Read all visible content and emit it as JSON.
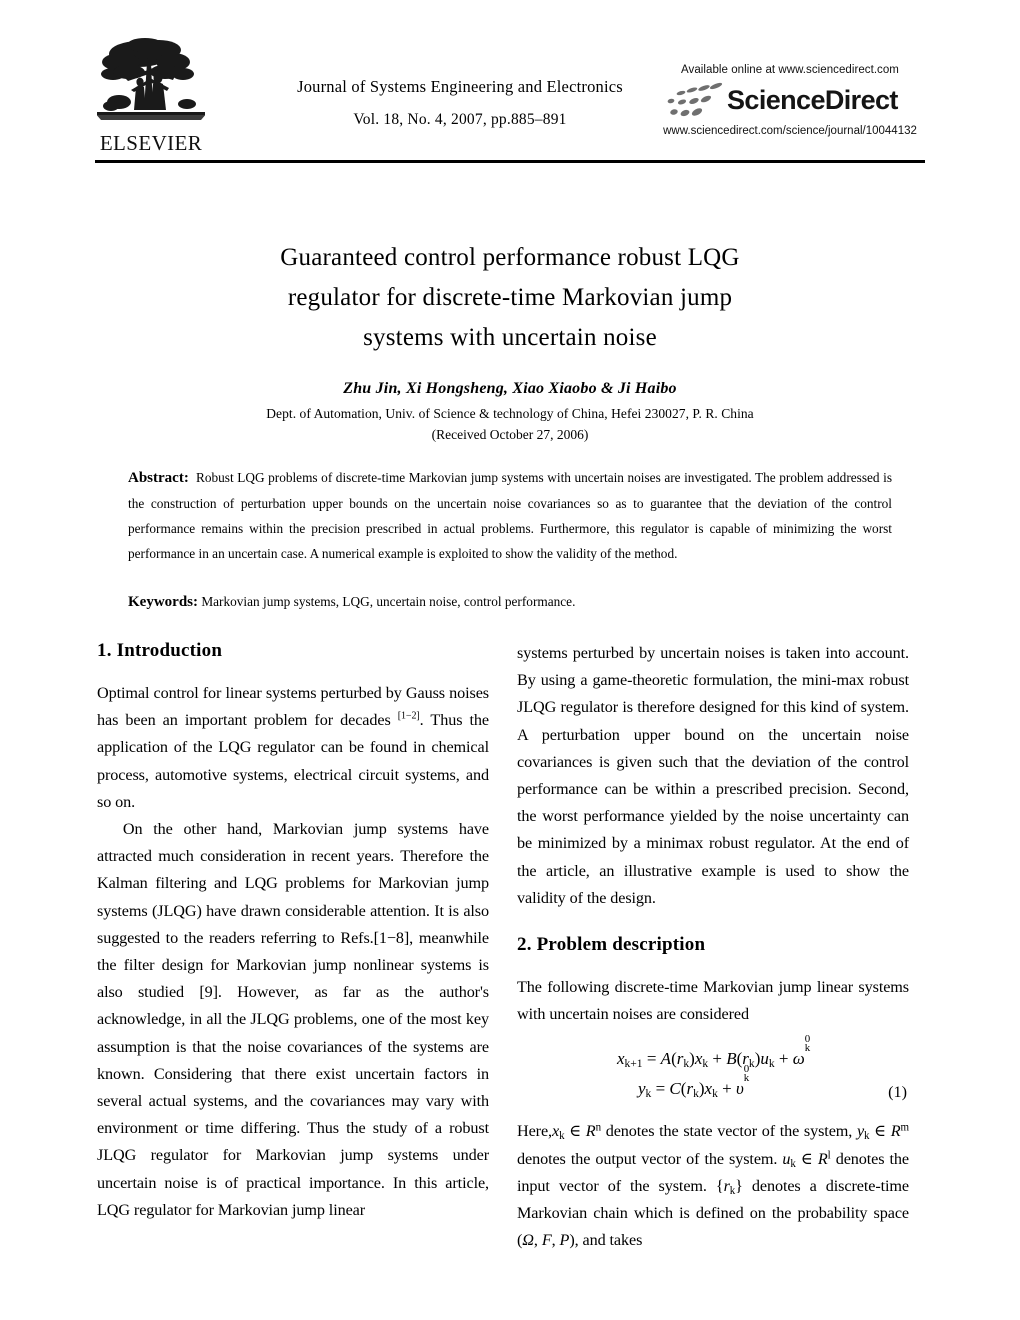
{
  "masthead": {
    "publisher_logo": "elsevier-tree-logo",
    "publisher_wordmark": "ELSEVIER",
    "journal_title": "Journal of Systems Engineering and Electronics",
    "journal_issue": "Vol. 18, No. 4, 2007, pp.885–891",
    "sciencedirect": {
      "available_line": "Available online at www.sciencedirect.com",
      "wordmark": "ScienceDirect",
      "url": "www.sciencedirect.com/science/journal/10044132",
      "swoosh_color": "#6f6f6f"
    }
  },
  "title_block": {
    "title_lines": [
      "Guaranteed control performance robust LQG",
      "regulator for discrete-time Markovian jump",
      "systems with uncertain noise"
    ],
    "authors": "Zhu Jin, Xi Hongsheng, Xiao Xiaobo & Ji Haibo",
    "affiliation": "Dept. of Automation, Univ. of Science & technology of China, Hefei 230027, P. R. China",
    "received": "(Received October 27, 2006)"
  },
  "abstract": {
    "label": "Abstract:",
    "text": "Robust LQG problems of discrete-time Markovian jump systems with uncertain noises are investigated. The problem addressed is the construction of perturbation upper bounds on the uncertain noise covariances so as to guarantee that the deviation of the control performance remains within the precision prescribed in actual problems. Furthermore, this regulator is capable of minimizing the worst performance in an uncertain case. A numerical example is exploited to show the validity of the method."
  },
  "keywords": {
    "label": "Keywords:",
    "text": "Markovian jump systems, LQG, uncertain noise, control performance."
  },
  "left_column": {
    "section_1_heading": "1. Introduction",
    "para_1_a": "Optimal control for linear systems perturbed by Gauss noises has been an important problem for decades ",
    "para_1_ref": "[1−2]",
    "para_1_b": ". Thus the application of the LQG regulator can be found in chemical process, automotive systems, electrical circuit systems, and so on.",
    "para_2": "On the other hand, Markovian jump systems have attracted much consideration in recent years. Therefore the Kalman filtering and LQG problems for Markovian jump systems (JLQG) have drawn considerable attention. It is also suggested to the readers referring to Refs.[1−8], meanwhile the filter design for Markovian jump nonlinear systems is also studied [9]. However, as far as the author's acknowledge, in all the JLQG problems, one of the most key assumption is that the noise covariances of the systems are known. Considering that there exist uncertain factors in several actual systems, and the covariances may vary with environment or time differing. Thus the study of a robust JLQG regulator for Markovian jump systems under uncertain noise is of practical importance. In this article, LQG regulator for Markovian jump linear"
  },
  "right_column": {
    "para_continued": "systems perturbed by uncertain noises is taken into account. By using a game-theoretic formulation, the mini-max robust JLQG regulator is therefore designed for this kind of system. A perturbation upper bound on the uncertain noise covariances is given such that the deviation of the control performance can be within a prescribed precision. Second, the worst performance yielded by the noise uncertainty can be minimized by a minimax robust regulator. At the end of the article, an illustrative example is used to show the validity of the design.",
    "section_2_heading": "2. Problem description",
    "para_intro": "The following discrete-time Markovian jump linear systems with uncertain noises are considered",
    "equation": {
      "line_1": "x_{k+1} = A(r_k)x_k + B(r_k)u_k + ω⁰_k",
      "line_2": "y_k = C(r_k)x_k + υ⁰_k",
      "number": "(1)"
    },
    "para_after_eq": "Here,x_k ∈ Rⁿ denotes the state vector of the system, y_k ∈ Rᵐ denotes the output vector of the system. u_k ∈ Rˡ denotes the input vector of the system. {r_k} denotes a discrete-time Markovian chain which is defined on the probability space (Ω, F, P), and takes"
  }
}
